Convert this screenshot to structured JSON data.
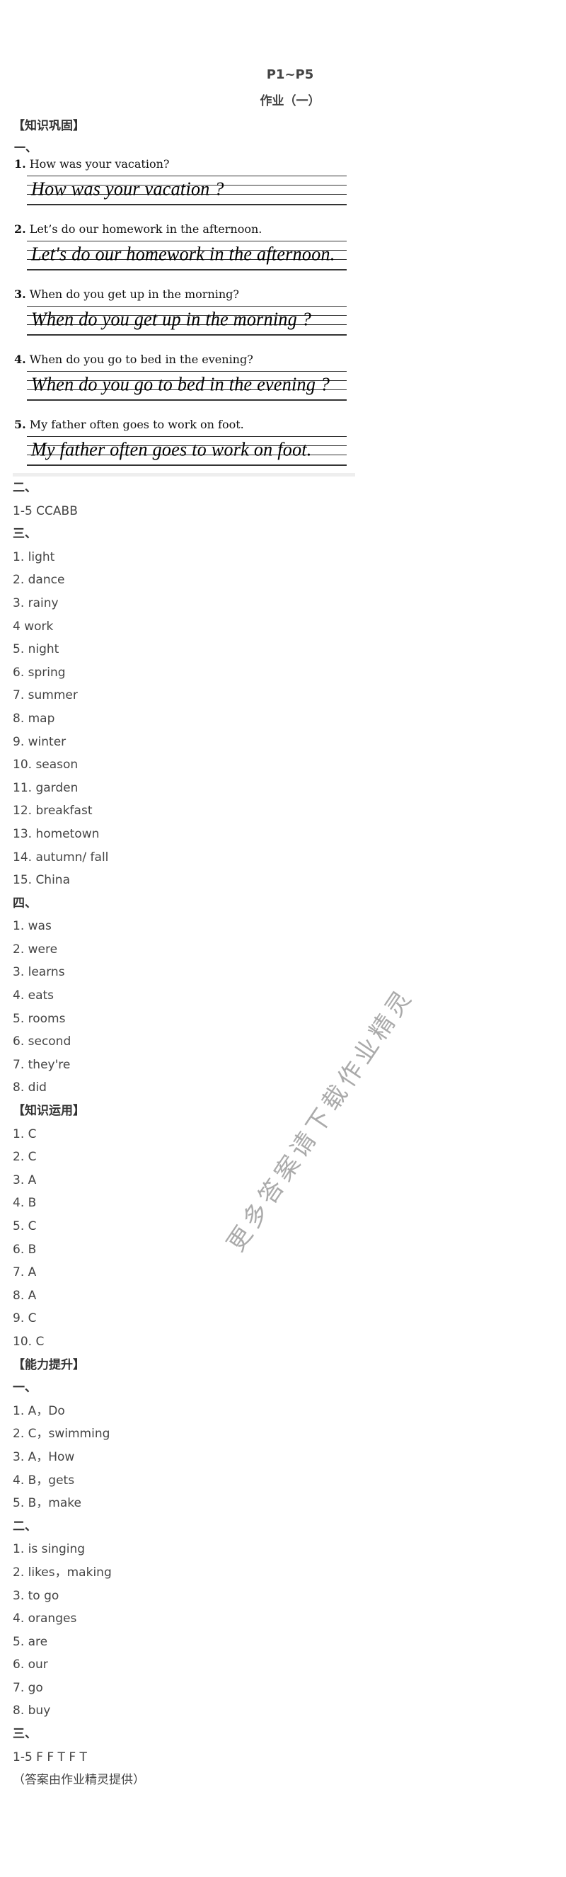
{
  "header": {
    "pages": "P1~P5",
    "assignment": "作业（一）"
  },
  "section1_title": "【知识巩固】",
  "scan": {
    "part": "一、",
    "questions": [
      {
        "num": "1.",
        "prompt": "How was your vacation?",
        "written": "How was your vacation ?"
      },
      {
        "num": "2.",
        "prompt": "Let’s do our homework in the afternoon.",
        "written": "Let's do our homework in the afternoon."
      },
      {
        "num": "3.",
        "prompt": "When do you get up in the morning?",
        "written": "When do you get up in the morning ?"
      },
      {
        "num": "4.",
        "prompt": "When do you go to bed in the evening?",
        "written": "When do you go to bed in the evening ?"
      },
      {
        "num": "5.",
        "prompt": "My father often goes to work on foot.",
        "written": "My father often goes to work on foot."
      }
    ]
  },
  "lines": [
    {
      "text": "二、",
      "bold": true
    },
    {
      "text": "1-5 CCABB"
    },
    {
      "text": "三、",
      "bold": true
    },
    {
      "text": "1. light"
    },
    {
      "text": "2. dance"
    },
    {
      "text": "3. rainy"
    },
    {
      "text": "4 work"
    },
    {
      "text": "5. night"
    },
    {
      "text": "6. spring"
    },
    {
      "text": "7. summer"
    },
    {
      "text": "8. map"
    },
    {
      "text": "9. winter"
    },
    {
      "text": "10. season"
    },
    {
      "text": "11. garden"
    },
    {
      "text": "12. breakfast"
    },
    {
      "text": "13. hometown"
    },
    {
      "text": "14. autumn/ fall"
    },
    {
      "text": "15. China"
    },
    {
      "text": "四、",
      "bold": true
    },
    {
      "text": "1. was"
    },
    {
      "text": "2. were"
    },
    {
      "text": "3. learns"
    },
    {
      "text": "4. eats"
    },
    {
      "text": "5. rooms"
    },
    {
      "text": "6. second"
    },
    {
      "text": "7. they're"
    },
    {
      "text": "8. did"
    },
    {
      "text": "【知识运用】",
      "bold": true
    },
    {
      "text": "1. C"
    },
    {
      "text": "2. C"
    },
    {
      "text": "3. A"
    },
    {
      "text": "4. B"
    },
    {
      "text": "5. C"
    },
    {
      "text": "6. B"
    },
    {
      "text": "7. A"
    },
    {
      "text": "8. A"
    },
    {
      "text": "9. C"
    },
    {
      "text": "10. C"
    },
    {
      "text": "【能力提升】",
      "bold": true
    },
    {
      "text": "一、",
      "bold": true
    },
    {
      "text": "1. A，Do"
    },
    {
      "text": "2. C，swimming"
    },
    {
      "text": "3. A，How"
    },
    {
      "text": "4. B，gets"
    },
    {
      "text": "5. B，make"
    },
    {
      "text": "二、",
      "bold": true
    },
    {
      "text": "1. is singing"
    },
    {
      "text": "2. likes，making"
    },
    {
      "text": "3. to go"
    },
    {
      "text": "4. oranges"
    },
    {
      "text": "5. are"
    },
    {
      "text": "6. our"
    },
    {
      "text": "7. go"
    },
    {
      "text": "8. buy"
    },
    {
      "text": "三、",
      "bold": true
    },
    {
      "text": "1-5 F F T F T"
    },
    {
      "text": "（答案由作业精灵提供）"
    }
  ],
  "watermark": "更多答案请下载作业精灵"
}
